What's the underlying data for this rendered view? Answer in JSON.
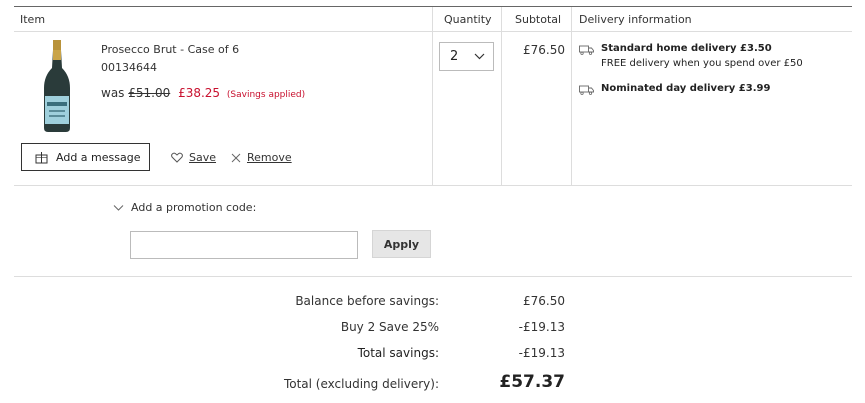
{
  "table_header": {
    "item": "Item",
    "quantity": "Quantity",
    "subtotal": "Subtotal",
    "delivery": "Delivery information"
  },
  "product": {
    "image_icon": "prosecco-bottle-image",
    "name": "Prosecco Brut - Case of 6",
    "sku": "00134644",
    "was_label": "was",
    "was_price": "£51.00",
    "now_price": "£38.25",
    "savings_note": "(Savings applied)",
    "quantity": "2",
    "subtotal": "£76.50"
  },
  "actions": {
    "add_message": "Add a message",
    "add_message_icon": "gift-icon",
    "save": "Save",
    "save_icon": "heart-icon",
    "remove": "Remove",
    "remove_icon": "close-icon"
  },
  "delivery": {
    "standard_title": "Standard home delivery £3.50",
    "standard_note": "FREE delivery when you spend over £50",
    "nominated_title": "Nominated day delivery £3.99",
    "icon": "truck-icon"
  },
  "promo": {
    "toggle_label": "Add a promotion code:",
    "input_value": "",
    "input_placeholder": "",
    "apply_label": "Apply"
  },
  "summary": {
    "balance_label": "Balance before savings:",
    "balance_value": "£76.50",
    "offer_label": "Buy 2 Save 25%",
    "offer_value": "-£19.13",
    "total_savings_label": "Total savings:",
    "total_savings_value": "-£19.13",
    "total_label": "Total (excluding delivery):",
    "total_value": "£57.37"
  },
  "colors": {
    "sale_red": "#c8102e",
    "border": "#dddddd",
    "button_grey": "#e6e6e6"
  }
}
